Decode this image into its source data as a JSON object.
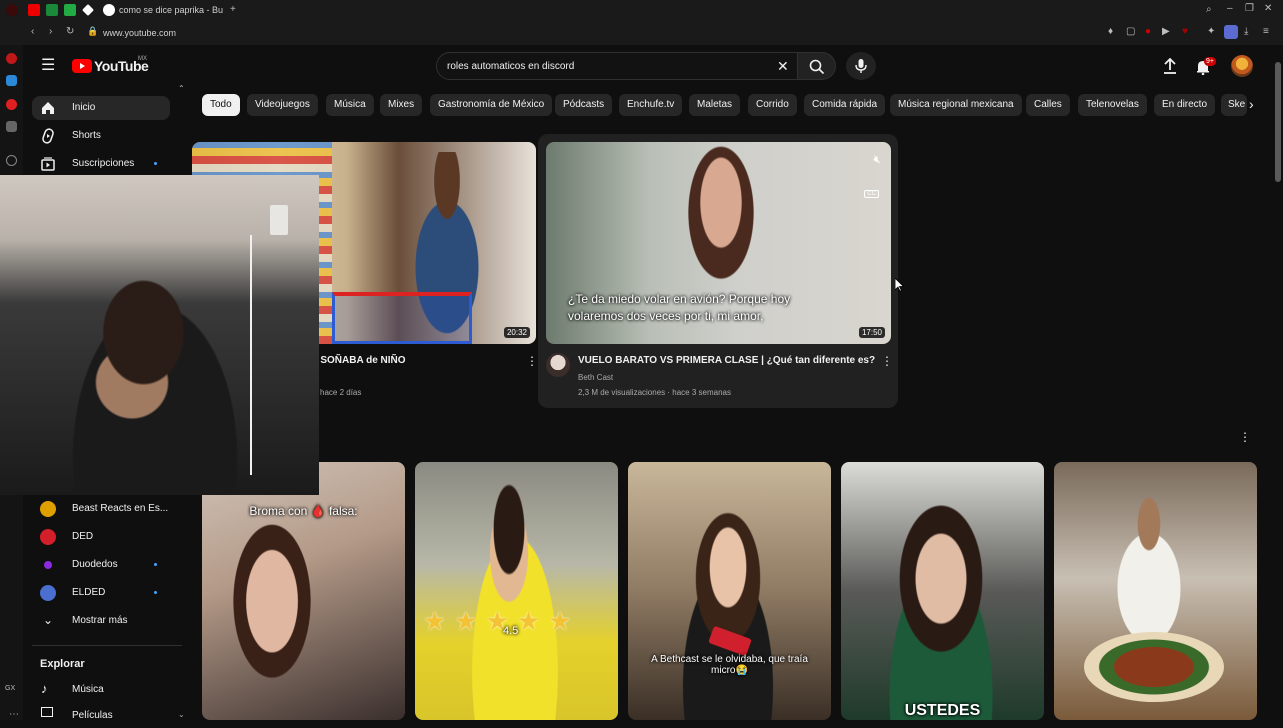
{
  "browser": {
    "tab_title": "como se dice paprika - Bu",
    "url": "www.youtube.com"
  },
  "header": {
    "logo_text": "YouTube",
    "logo_region": "MX",
    "search_value": "roles automaticos en discord",
    "notif_count": "9+"
  },
  "chips": [
    "Todo",
    "Videojuegos",
    "Música",
    "Mixes",
    "Gastronomía de México",
    "Pódcasts",
    "Enchufe.tv",
    "Maletas",
    "Corrido",
    "Comida rápida",
    "Música regional mexicana",
    "Calles",
    "Telenovelas",
    "En directo",
    "Ske"
  ],
  "sidebar": {
    "items": [
      {
        "label": "Inicio",
        "icon": "home-icon"
      },
      {
        "label": "Shorts",
        "icon": "shorts-icon"
      },
      {
        "label": "Suscripciones",
        "icon": "subscriptions-icon"
      }
    ],
    "subscriptions": [
      {
        "label": "Beast Reacts en Es...",
        "color": "#e0a000"
      },
      {
        "label": "DED",
        "color": "#d21f2a"
      },
      {
        "label": "Duodedos",
        "color": "#8a2be2"
      },
      {
        "label": "ELDED",
        "color": "#4a6fd0"
      }
    ],
    "show_more": "Mostrar más",
    "explore_heading": "Explorar",
    "explore_items": [
      {
        "label": "Música",
        "icon": "music-icon"
      },
      {
        "label": "Películas",
        "icon": "movies-icon"
      }
    ]
  },
  "videos": [
    {
      "title": "e SOÑABA  de NIÑO",
      "meta": "hace 2 días",
      "duration": "20:32"
    },
    {
      "title": "VUELO BARATO VS PRIMERA CLASE | ¿Qué tan diferente es?",
      "channel": "Beth Cast",
      "meta": "2,3 M de visualizaciones · hace 3 semanas",
      "duration": "17:50",
      "caption_line1": "¿Te da miedo volar en avión? Porque hoy",
      "caption_line2": "volaremos dos veces por ti, mi amor,"
    }
  ],
  "shorts": [
    {
      "caption": "Broma con 🩸 falsa:"
    },
    {
      "caption": "4.5"
    },
    {
      "caption": "A Bethcast se le olvidaba, que traía micro😭"
    },
    {
      "caption": "USTEDES"
    },
    {
      "caption": ""
    }
  ]
}
